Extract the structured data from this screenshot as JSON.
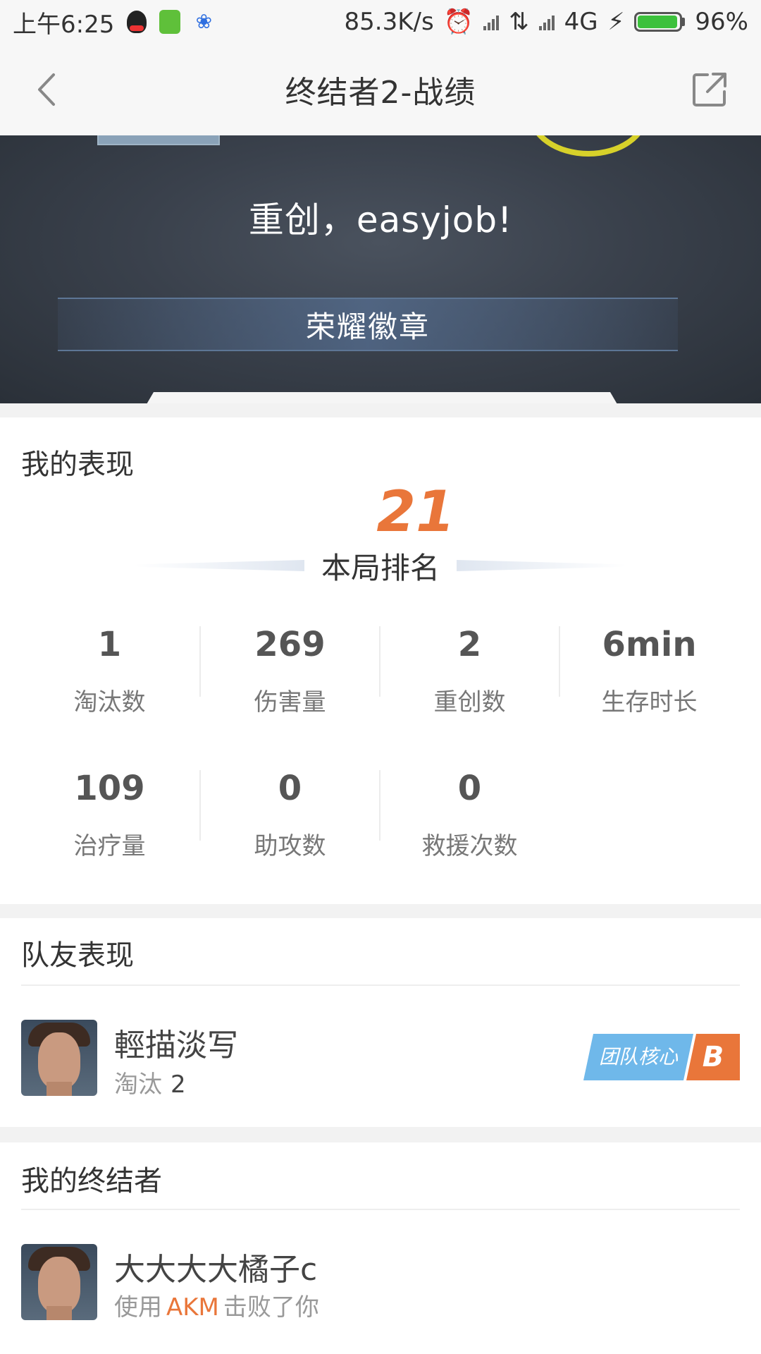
{
  "status_bar": {
    "time": "上午6:25",
    "net_speed": "85.3K/s",
    "network": "4G",
    "battery": "96%",
    "battery_level": 0.96
  },
  "nav": {
    "title": "终结者2-战绩"
  },
  "hero": {
    "message": "重创，easyjob!",
    "badge_label": "荣耀徽章"
  },
  "performance": {
    "title": "我的表现",
    "rank": "21",
    "rank_label": "本局排名",
    "stats": [
      {
        "value": "1",
        "label": "淘汰数"
      },
      {
        "value": "269",
        "label": "伤害量"
      },
      {
        "value": "2",
        "label": "重创数"
      },
      {
        "value": "6min",
        "label": "生存时长"
      },
      {
        "value": "109",
        "label": "治疗量"
      },
      {
        "value": "0",
        "label": "助攻数"
      },
      {
        "value": "0",
        "label": "救援次数"
      }
    ]
  },
  "teammates": {
    "title": "队友表现",
    "players": [
      {
        "name": "輕描淡写",
        "sub_label": "淘汰",
        "sub_value": "2",
        "role": "团队核心",
        "grade": "B"
      }
    ]
  },
  "killers": {
    "title": "我的终结者",
    "players": [
      {
        "name": "大大大大橘子c",
        "prefix": "使用",
        "weapon": "AKM",
        "suffix": "击败了你"
      }
    ]
  },
  "colors": {
    "accent_orange": "#e9763a",
    "badge_blue": "#6fb8ea",
    "hero_bg": "#3a414c"
  }
}
